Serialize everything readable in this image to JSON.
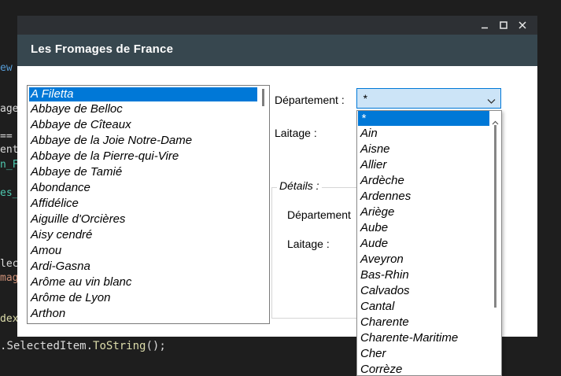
{
  "background": {
    "fragments": [
      "ew",
      "ages",
      "==",
      "ent",
      "n_F",
      "es_S",
      "lect",
      "mage",
      "dex("
    ],
    "bottom_code": [
      ".",
      "SelectedItem",
      ".",
      "ToString",
      "();"
    ]
  },
  "window": {
    "title": "Les Fromages de France",
    "controls": [
      "minimize-icon",
      "maximize-icon",
      "close-icon"
    ]
  },
  "cheese_list": {
    "items": [
      "A Filetta",
      "Abbaye de Belloc",
      "Abbaye de Cîteaux",
      "Abbaye de la Joie Notre-Dame",
      "Abbaye de la Pierre-qui-Vire",
      "Abbaye de Tamié",
      "Abondance",
      "Affidélice",
      "Aiguille d'Orcières",
      "Aisy cendré",
      "Amou",
      "Ardi-Gasna",
      "Arôme au vin blanc",
      "Arôme de Lyon",
      "Arthon"
    ],
    "selected_index": 0,
    "scroll_fraction": 0.0
  },
  "filters": {
    "departement_label": "Département :",
    "laitage_label": "Laitage :",
    "departement_value": "*"
  },
  "details": {
    "title": "Détails :",
    "departement_label": "Département",
    "laitage_label": "Laitage :"
  },
  "departement_dropdown": {
    "options": [
      "*",
      "Ain",
      "Aisne",
      "Allier",
      "Ardèche",
      "Ardennes",
      "Ariège",
      "Aube",
      "Aude",
      "Aveyron",
      "Bas-Rhin",
      "Calvados",
      "Cantal",
      "Charente",
      "Charente-Maritime",
      "Cher",
      "Corrèze"
    ],
    "selected_index": 0
  },
  "colors": {
    "header_bg": "#37474f",
    "titlebar_bg": "#2d3034",
    "selection": "#0078d7",
    "combo_bg": "#cce4f7"
  }
}
